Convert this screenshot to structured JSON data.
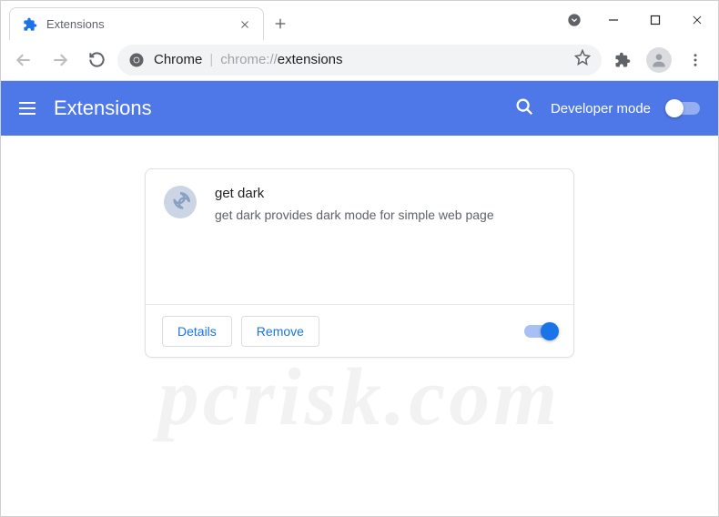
{
  "window": {
    "tab_title": "Extensions",
    "new_tab_tooltip": "New tab"
  },
  "omnibox": {
    "prefix": "Chrome",
    "path_dim": "chrome://",
    "path": "extensions"
  },
  "header": {
    "title": "Extensions",
    "dev_mode_label": "Developer mode",
    "dev_mode_on": false
  },
  "extension": {
    "name": "get dark",
    "description": "get dark provides dark mode for simple web page",
    "details_label": "Details",
    "remove_label": "Remove",
    "enabled": true
  },
  "watermark": "pcrisk.com"
}
